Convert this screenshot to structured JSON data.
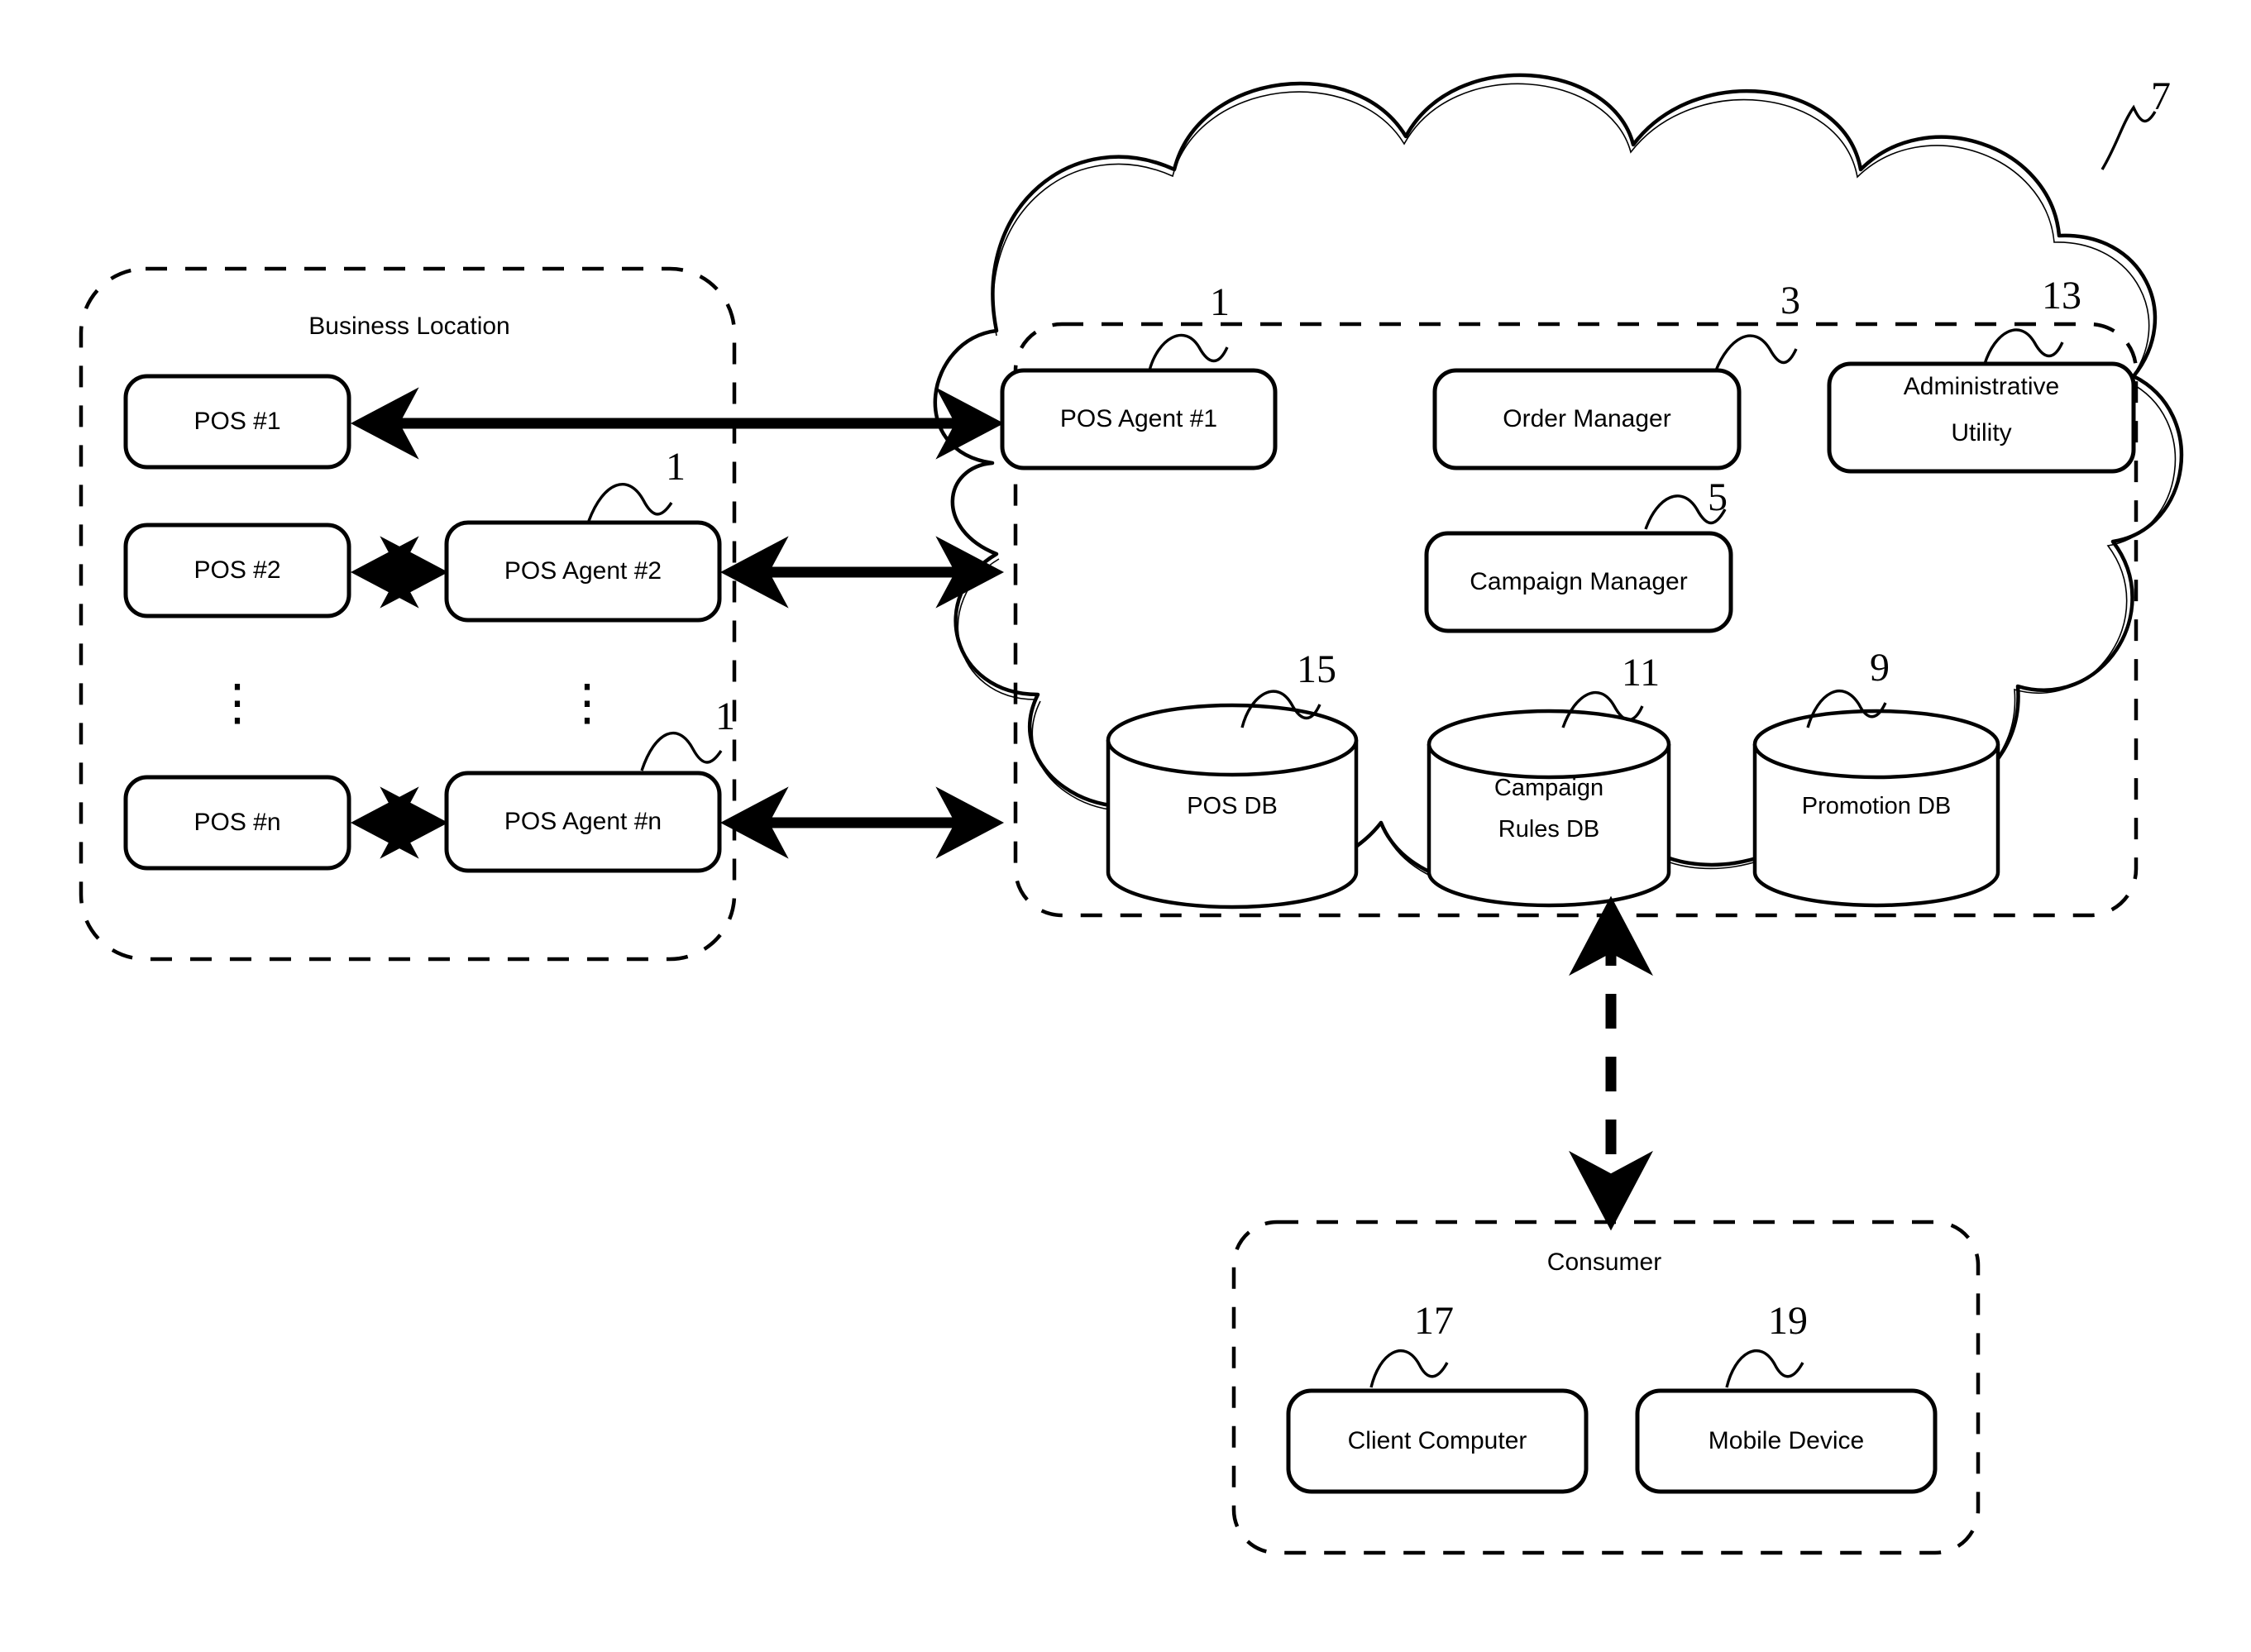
{
  "diagram": {
    "type": "patent-system-architecture",
    "title": "",
    "groups": [
      {
        "id": "business-location",
        "label": "Business Location",
        "style": "dashed-rounded-rect"
      },
      {
        "id": "cloud-network",
        "label": "",
        "style": "cloud",
        "ref": "7"
      },
      {
        "id": "cloud-inner",
        "label": "",
        "style": "dashed-rounded-rect"
      },
      {
        "id": "consumer",
        "label": "Consumer",
        "style": "dashed-rounded-rect"
      }
    ],
    "business_location": {
      "label": "Business Location",
      "pos_terminals": [
        {
          "label": "POS #1"
        },
        {
          "label": "POS #2"
        },
        {
          "label": "POS #n"
        }
      ],
      "pos_agents": [
        {
          "label": "POS Agent #2",
          "ref": "1"
        },
        {
          "label": "POS Agent #n",
          "ref": "1"
        }
      ],
      "ellipsis": "⋮"
    },
    "cloud": {
      "ref": "7",
      "components": [
        {
          "label": "POS Agent #1",
          "ref": "1",
          "shape": "rounded-rect"
        },
        {
          "label": "Order Manager",
          "ref": "3",
          "shape": "rounded-rect"
        },
        {
          "label": "Administrative Utility",
          "line1": "Administrative",
          "line2": "Utility",
          "ref": "13",
          "shape": "rounded-rect"
        },
        {
          "label": "Campaign Manager",
          "ref": "5",
          "shape": "rounded-rect"
        }
      ],
      "databases": [
        {
          "label": "POS DB",
          "ref": "15",
          "shape": "cylinder"
        },
        {
          "label": "Campaign Rules DB",
          "line1": "Campaign",
          "line2": "Rules DB",
          "ref": "11",
          "shape": "cylinder"
        },
        {
          "label": "Promotion DB",
          "ref": "9",
          "shape": "cylinder"
        }
      ]
    },
    "consumer": {
      "label": "Consumer",
      "devices": [
        {
          "label": "Client Computer",
          "ref": "17"
        },
        {
          "label": "Mobile Device",
          "ref": "19"
        }
      ]
    },
    "connections": [
      {
        "from": "POS #1",
        "to": "POS Agent #1",
        "style": "double-arrow"
      },
      {
        "from": "POS #2",
        "to": "POS Agent #2",
        "style": "double-arrow"
      },
      {
        "from": "POS Agent #2",
        "to": "cloud-inner",
        "style": "double-arrow"
      },
      {
        "from": "POS #n",
        "to": "POS Agent #n",
        "style": "double-arrow"
      },
      {
        "from": "POS Agent #n",
        "to": "cloud-inner",
        "style": "double-arrow"
      },
      {
        "from": "cloud-inner",
        "to": "Consumer",
        "style": "dashed-double-arrow-vertical"
      }
    ],
    "colors": {
      "stroke": "#000000",
      "background": "#ffffff"
    }
  }
}
